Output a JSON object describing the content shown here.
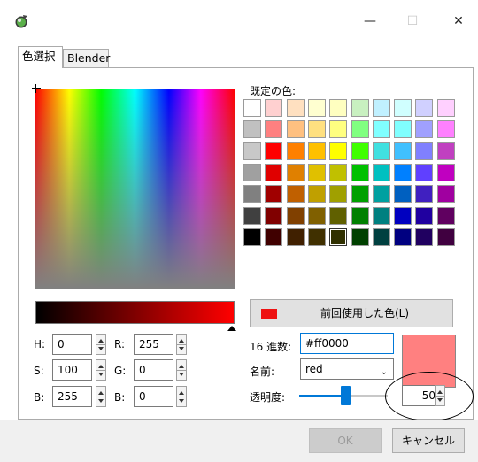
{
  "window": {
    "title_icon": "color-palette-app-icon",
    "controls": {
      "minimize": "—",
      "maximize": "☐",
      "close": "✕"
    }
  },
  "tabs": [
    {
      "label": "色選択",
      "active": true
    },
    {
      "label": "Blender",
      "active": false
    }
  ],
  "palette": {
    "label": "既定の色:",
    "rows": [
      [
        "#ffffff",
        "#ffd0d0",
        "#ffe0c0",
        "#ffffd0",
        "#ffffc0",
        "#c8f0c0",
        "#c0f0ff",
        "#d0ffff",
        "#d0d0ff",
        "#ffd0ff"
      ],
      [
        "#c0c0c0",
        "#ff8080",
        "#ffc080",
        "#ffe080",
        "#ffff80",
        "#80ff80",
        "#80ffff",
        "#80ffff",
        "#a0a0ff",
        "#ff80ff"
      ],
      [
        "#c8c8c8",
        "#ff0000",
        "#ff8000",
        "#ffc000",
        "#ffff00",
        "#40ff00",
        "#40e0e0",
        "#40c0ff",
        "#8080ff",
        "#c040c0"
      ],
      [
        "#a0a0a0",
        "#e00000",
        "#e08000",
        "#e0c000",
        "#c0c000",
        "#00c000",
        "#00c0c0",
        "#0080ff",
        "#6040ff",
        "#c000c0"
      ],
      [
        "#808080",
        "#a00000",
        "#c06000",
        "#c0a000",
        "#a0a000",
        "#00a000",
        "#00a0a0",
        "#0060c0",
        "#4020c0",
        "#a000a0"
      ],
      [
        "#404040",
        "#800000",
        "#804000",
        "#806000",
        "#606000",
        "#008000",
        "#008080",
        "#0000c0",
        "#2000a0",
        "#600060"
      ],
      [
        "#000000",
        "#400000",
        "#402000",
        "#403000",
        "#303000",
        "#004000",
        "#004040",
        "#000080",
        "#200060",
        "#400040"
      ]
    ],
    "selected": [
      6,
      4
    ]
  },
  "recent": {
    "label": "前回使用した色(L)",
    "swatch_color": "#ee1111"
  },
  "hsb": {
    "h_label": "H:",
    "h_value": "0",
    "s_label": "S:",
    "s_value": "100",
    "b_label": "B:",
    "b_value": "255"
  },
  "rgb": {
    "r_label": "R:",
    "r_value": "255",
    "g_label": "G:",
    "g_value": "0",
    "b_label": "B:",
    "b_value": "0"
  },
  "hex": {
    "label": "16 進数:",
    "value": "#ff0000"
  },
  "name": {
    "label": "名前:",
    "value": "red"
  },
  "opacity": {
    "label": "透明度:",
    "value": "50",
    "slider_fraction": 0.52
  },
  "preview_color": "#ff8080",
  "buttons": {
    "ok": "OK",
    "cancel": "キャンセル"
  }
}
